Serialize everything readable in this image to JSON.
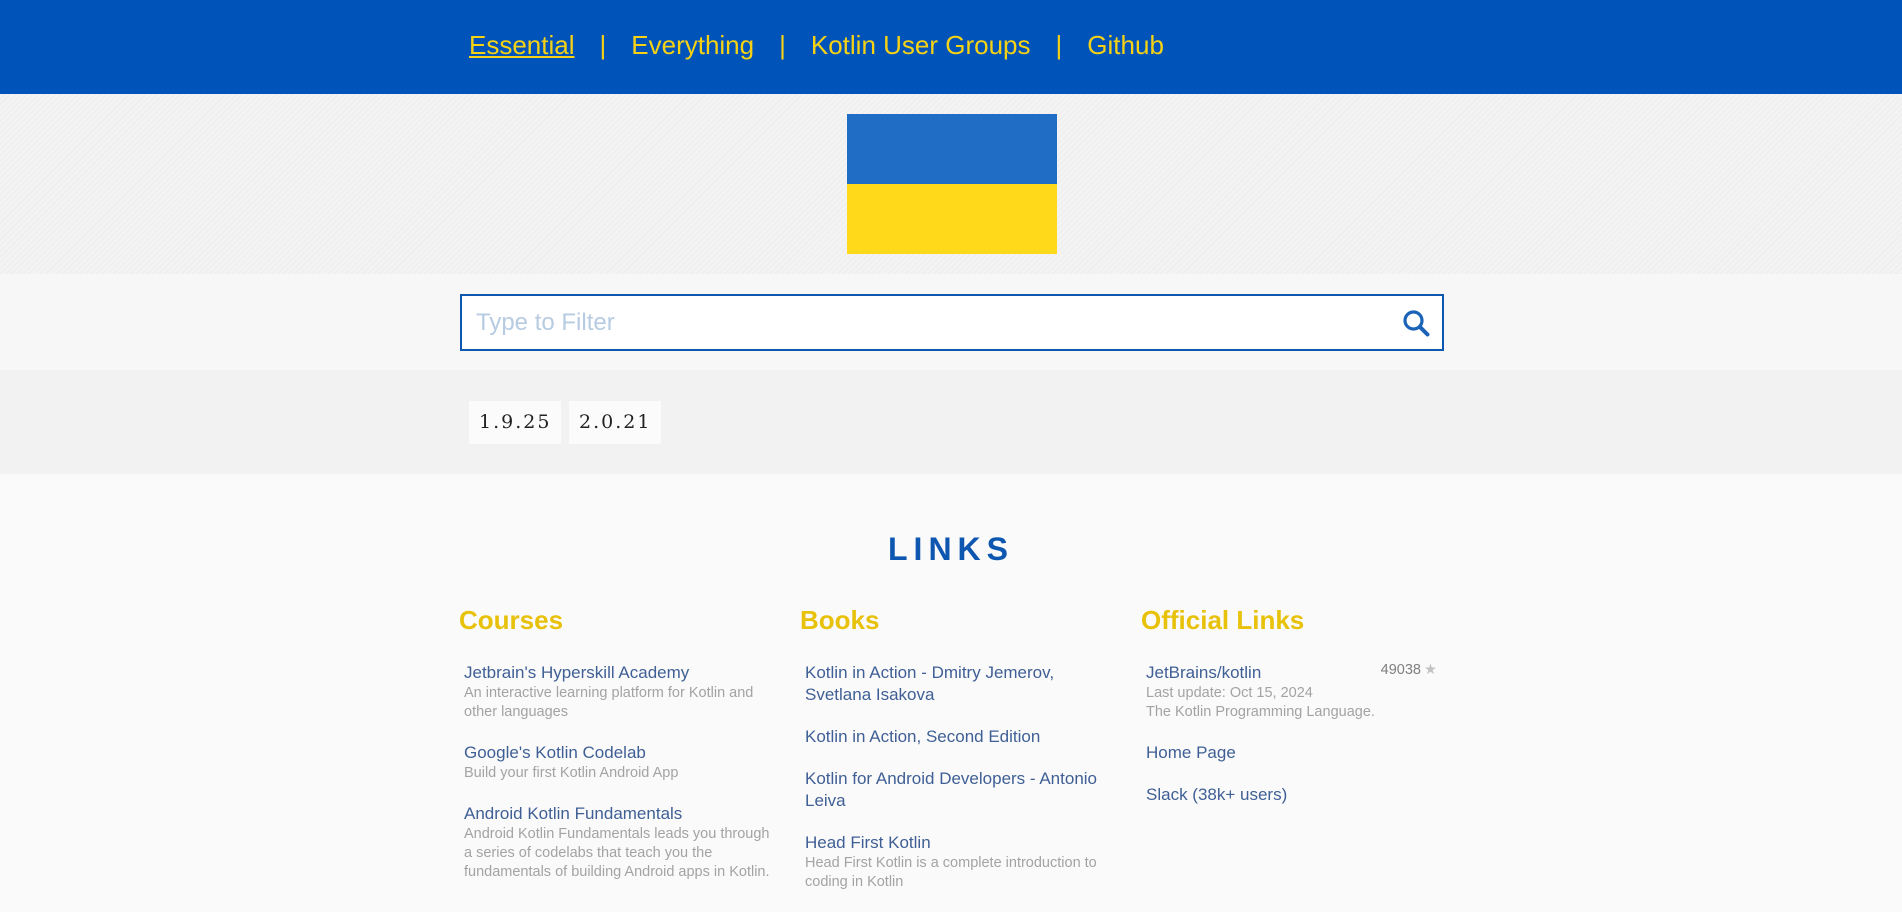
{
  "nav": {
    "items": [
      {
        "label": "Essential",
        "active": true
      },
      {
        "label": "Everything",
        "active": false
      },
      {
        "label": "Kotlin User Groups",
        "active": false
      },
      {
        "label": "Github",
        "active": false
      }
    ],
    "separator": "|"
  },
  "flag": {
    "top_color": "#1f6dc5",
    "bottom_color": "#ffd91a"
  },
  "search": {
    "placeholder": "Type to Filter",
    "value": "",
    "icon": "search-icon"
  },
  "versions": [
    "1.9.25",
    "2.0.21"
  ],
  "links": {
    "title": "LINKS",
    "columns": [
      {
        "heading": "Courses",
        "items": [
          {
            "title": "Jetbrain's Hyperskill Academy",
            "desc": "An interactive learning platform for Kotlin and other languages"
          },
          {
            "title": "Google's Kotlin Codelab",
            "desc": "Build your first Kotlin Android App"
          },
          {
            "title": "Android Kotlin Fundamentals",
            "desc": "Android Kotlin Fundamentals leads you through a series of codelabs that teach you the fundamentals of building Android apps in Kotlin."
          }
        ]
      },
      {
        "heading": "Books",
        "items": [
          {
            "title": "Kotlin in Action - Dmitry Jemerov, Svetlana Isakova",
            "desc": ""
          },
          {
            "title": "Kotlin in Action, Second Edition",
            "desc": ""
          },
          {
            "title": "Kotlin for Android Developers - Antonio Leiva",
            "desc": ""
          },
          {
            "title": "Head First Kotlin",
            "desc": "Head First Kotlin is a complete introduction to coding in Kotlin"
          }
        ]
      },
      {
        "heading": "Official Links",
        "items": [
          {
            "title": "JetBrains/kotlin",
            "stars": "49038",
            "update": "Last update: Oct 15, 2024",
            "desc": "The Kotlin Programming Language."
          },
          {
            "title": "Home Page",
            "desc": ""
          },
          {
            "title": "Slack (38k+ users)",
            "desc": ""
          }
        ]
      }
    ]
  },
  "colors": {
    "nav_bg": "#0054b9",
    "accent_yellow": "#f7d214",
    "heading_blue": "#0e57b0",
    "link": "#3f5f95"
  }
}
